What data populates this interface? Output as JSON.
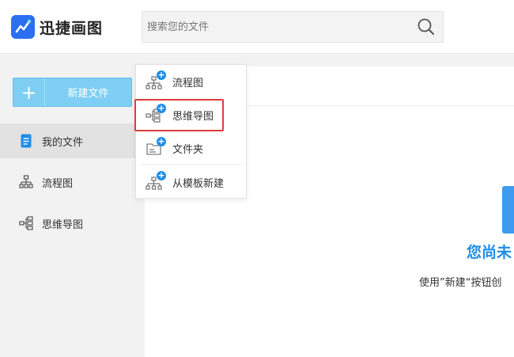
{
  "app": {
    "logo_text": "迅捷画图"
  },
  "search": {
    "placeholder": "搜索您的文件",
    "value": ""
  },
  "sidebar": {
    "new_file_label": "新建文件",
    "items": [
      {
        "label": "我的文件",
        "icon": "document-icon",
        "active": true
      },
      {
        "label": "流程图",
        "icon": "flowchart-icon",
        "active": false
      },
      {
        "label": "思维导图",
        "icon": "mindmap-icon",
        "active": false
      }
    ]
  },
  "dropdown": {
    "items": [
      {
        "label": "流程图",
        "icon": "flowchart-add-icon"
      },
      {
        "label": "思维导图",
        "icon": "mindmap-add-icon",
        "highlighted": true
      },
      {
        "label": "文件夹",
        "icon": "folder-add-icon"
      },
      {
        "label": "从模板新建",
        "icon": "template-add-icon"
      }
    ]
  },
  "main": {
    "empty_title": "您尚未",
    "empty_hint": "使用”新建“按钮创"
  },
  "colors": {
    "accent": "#1f8de8",
    "new_button": "#7fcff5",
    "highlight": "#e03b3b",
    "logo": "#2b6ff0"
  }
}
